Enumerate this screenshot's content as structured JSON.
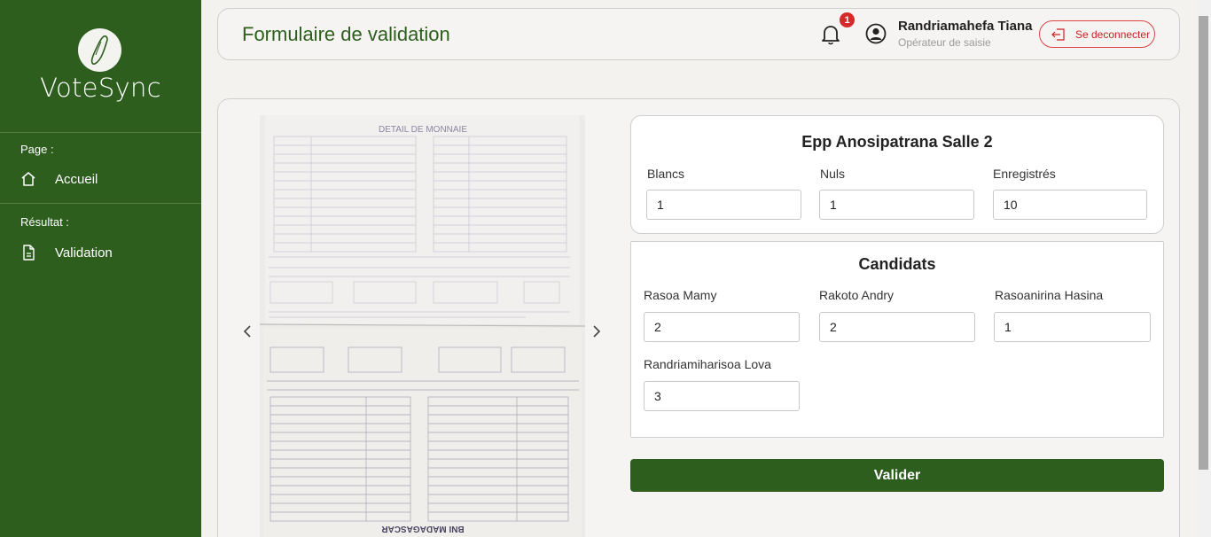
{
  "sidebar": {
    "brand": "VoteSync",
    "section_page": "Page :",
    "accueil": "Accueil",
    "section_resultat": "Résultat :",
    "validation": "Validation"
  },
  "header": {
    "title": "Formulaire de validation",
    "notification_count": "1",
    "user_name": "Randriamahefa Tiana",
    "user_role": "Opérateur de saisie",
    "logout_label": "Se deconnecter"
  },
  "photo": {
    "top_heading": "DETAIL DE MONNAIE",
    "bank": "BNI MADAGASCAR"
  },
  "bureau": {
    "title": "Epp Anosipatrana Salle 2",
    "fields": [
      {
        "label": "Blancs",
        "value": "1"
      },
      {
        "label": "Nuls",
        "value": "1"
      },
      {
        "label": "Enregistrés",
        "value": "10"
      }
    ]
  },
  "candidats": {
    "title": "Candidats",
    "fields": [
      {
        "label": "Rasoa Mamy",
        "value": "2"
      },
      {
        "label": "Rakoto Andry",
        "value": "2"
      },
      {
        "label": "Rasoanirina Hasina",
        "value": "1"
      },
      {
        "label": "Randriamiharisoa Lova",
        "value": "3"
      }
    ]
  },
  "submit_label": "Valider",
  "colors": {
    "brand_green": "#2d5e1e",
    "danger": "#d42a2a"
  }
}
